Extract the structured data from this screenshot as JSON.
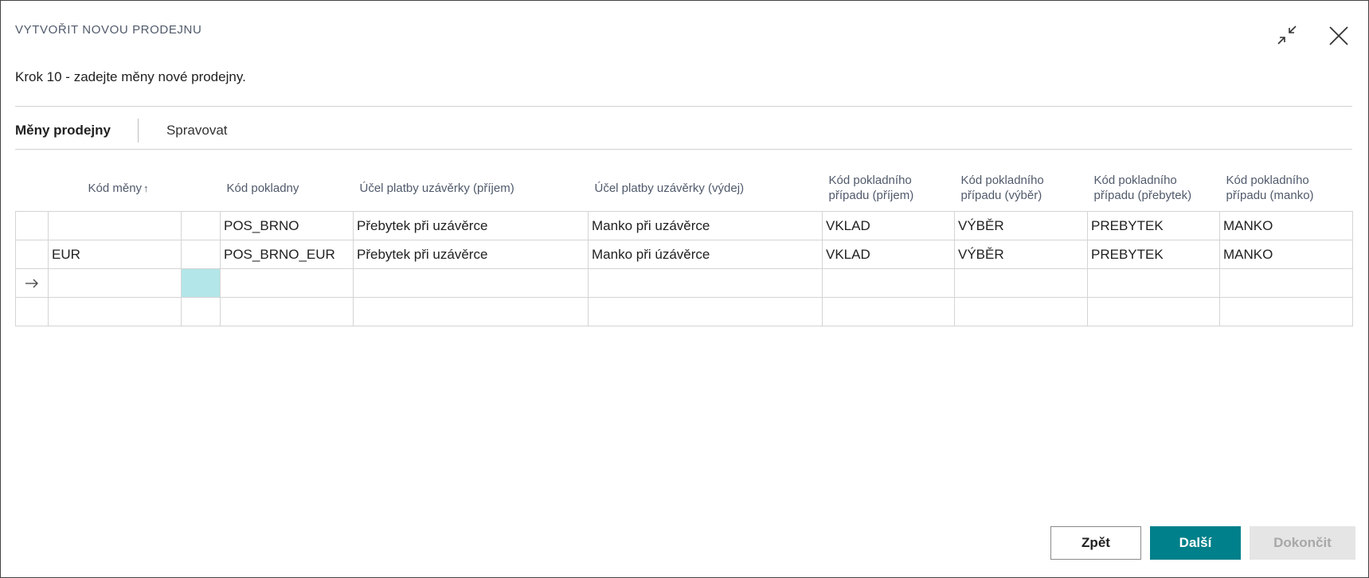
{
  "dialog": {
    "title": "VYTVOŘIT NOVOU PRODEJNU",
    "step_text": "Krok 10 - zadejte měny nové prodejny."
  },
  "tabs": [
    {
      "label": "Měny prodejny",
      "active": true
    },
    {
      "label": "Spravovat",
      "active": false
    }
  ],
  "table": {
    "columns": [
      "",
      "Kód měny",
      "",
      "Kód pokladny",
      "Účel platby uzávěrky (příjem)",
      "Účel platby uzávěrky (výdej)",
      "Kód pokladního případu (příjem)",
      "Kód pokladního případu (výběr)",
      "Kód pokladního případu (přebytek)",
      "Kód pokladního případu (manko)"
    ],
    "sort_indicator": "↑",
    "rows": [
      [
        "",
        "",
        "",
        "POS_BRNO",
        "Přebytek při uzávěrce",
        "Manko při uzávěrce",
        "VKLAD",
        "VÝBĚR",
        "PREBYTEK",
        "MANKO"
      ],
      [
        "",
        "EUR",
        "",
        "POS_BRNO_EUR",
        "Přebytek při uzávěrce",
        "Manko při úzávěrce",
        "VKLAD",
        "VÝBĚR",
        "PREBYTEK",
        "MANKO"
      ],
      [
        "",
        "",
        "",
        "",
        "",
        "",
        "",
        "",
        "",
        ""
      ],
      [
        "",
        "",
        "",
        "",
        "",
        "",
        "",
        "",
        "",
        ""
      ]
    ],
    "current_row_icon": "arrow-right-icon"
  },
  "buttons": {
    "back": "Zpět",
    "next": "Další",
    "finish": "Dokončit"
  },
  "colors": {
    "accent": "#00808a",
    "selected_cell": "#b3e6e8",
    "disabled_bg": "#e5e5e5"
  }
}
